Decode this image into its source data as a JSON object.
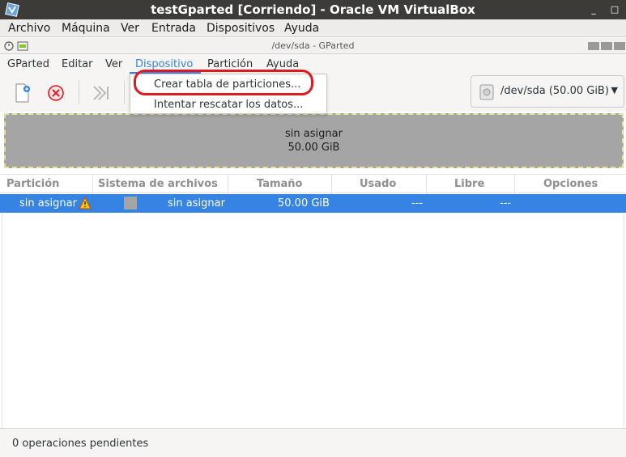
{
  "vbox": {
    "title": "testGparted [Corriendo] - Oracle VM VirtualBox",
    "logo_icon": "virtualbox-logo-icon",
    "minimize_glyph": "_",
    "restore_glyph": "□",
    "menu": [
      "Archivo",
      "Máquina",
      "Ver",
      "Entrada",
      "Dispositivos",
      "Ayuda"
    ]
  },
  "gparted": {
    "window_title": "/dev/sda - GParted",
    "menu": [
      "GParted",
      "Editar",
      "Ver",
      "Dispositivo",
      "Partición",
      "Ayuda"
    ],
    "active_menu": "Dispositivo",
    "toolbar_icons": [
      "new-partition-icon",
      "delete-partition-icon",
      "apply-all-icon"
    ],
    "device_selector": "/dev/sda (50.00 GiB)",
    "device_icon": "hard-disk-icon",
    "dropdown": [
      "Crear tabla de particiones...",
      "Intentar rescatar los datos..."
    ],
    "disk_graphic": {
      "label": "sin asignar",
      "size": "50.00 GiB"
    },
    "columns": [
      "Partición",
      "Sistema de archivos",
      "Tamaño",
      "Usado",
      "Libre",
      "Opciones"
    ],
    "rows": [
      {
        "partition": "sin asignar",
        "filesystem": "sin asignar",
        "size": "50.00 GiB",
        "used": "---",
        "free": "---",
        "flags": ""
      }
    ],
    "status": "0 operaciones pendientes"
  },
  "colors": {
    "selection": "#3584e4",
    "highlight_ring": "#e0181f",
    "unallocated": "#a5a5a5"
  }
}
